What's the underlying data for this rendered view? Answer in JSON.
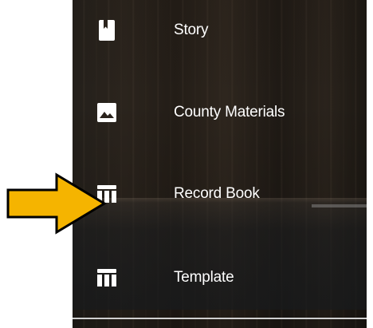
{
  "menu": {
    "items": [
      {
        "label": "Story",
        "icon": "book-icon"
      },
      {
        "label": "County Materials",
        "icon": "image-icon"
      },
      {
        "label": "Record Book",
        "icon": "table-icon"
      },
      {
        "label": "Template",
        "icon": "table-icon"
      }
    ]
  },
  "pointer": {
    "icon": "arrow-right-icon",
    "color": "#f5b400",
    "outline": "#000000"
  },
  "colors": {
    "label_text": "#ffffff",
    "icon": "#ffffff"
  }
}
